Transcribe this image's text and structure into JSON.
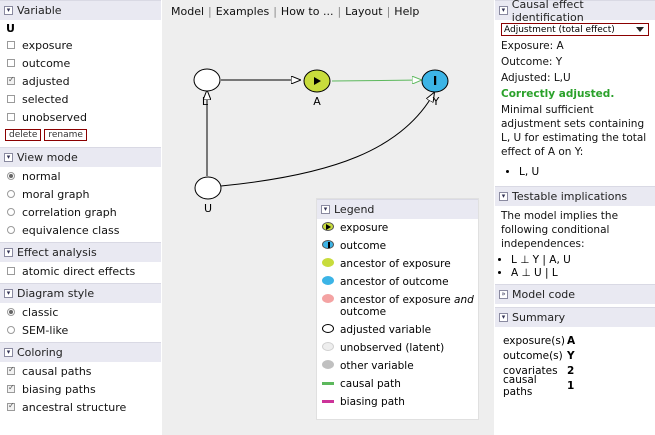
{
  "menu": {
    "items": [
      "Model",
      "Examples",
      "How to ...",
      "Layout",
      "Help"
    ]
  },
  "variable_panel": {
    "title": "Variable",
    "current_variable": "U",
    "options": [
      {
        "label": "exposure",
        "checked": false
      },
      {
        "label": "outcome",
        "checked": false
      },
      {
        "label": "adjusted",
        "checked": true
      },
      {
        "label": "selected",
        "checked": false
      },
      {
        "label": "unobserved",
        "checked": false
      }
    ],
    "delete_label": "delete",
    "rename_label": "rename"
  },
  "view_mode": {
    "title": "View mode",
    "options": [
      {
        "label": "normal",
        "selected": true
      },
      {
        "label": "moral graph",
        "selected": false
      },
      {
        "label": "correlation graph",
        "selected": false
      },
      {
        "label": "equivalence class",
        "selected": false
      }
    ]
  },
  "effect_analysis": {
    "title": "Effect analysis",
    "options": [
      {
        "label": "atomic direct effects",
        "checked": false
      }
    ]
  },
  "diagram_style": {
    "title": "Diagram style",
    "options": [
      {
        "label": "classic",
        "selected": true
      },
      {
        "label": "SEM-like",
        "selected": false
      }
    ]
  },
  "coloring": {
    "title": "Coloring",
    "options": [
      {
        "label": "causal paths",
        "checked": true
      },
      {
        "label": "biasing paths",
        "checked": true
      },
      {
        "label": "ancestral structure",
        "checked": true
      }
    ]
  },
  "graph": {
    "nodes": [
      {
        "id": "L",
        "label": "L",
        "role": "adjusted"
      },
      {
        "id": "A",
        "label": "A",
        "role": "exposure"
      },
      {
        "id": "Y",
        "label": "Y",
        "role": "outcome"
      },
      {
        "id": "U",
        "label": "U",
        "role": "adjusted"
      }
    ],
    "edges": [
      {
        "from": "L",
        "to": "A",
        "type": "plain"
      },
      {
        "from": "A",
        "to": "Y",
        "type": "causal"
      },
      {
        "from": "U",
        "to": "L",
        "type": "plain"
      },
      {
        "from": "U",
        "to": "Y",
        "type": "plain"
      }
    ],
    "colors": {
      "exposure": "#c8dc3c",
      "outcome": "#3cb4e6",
      "causal": "#5cb85c",
      "biasing": "#cc3399",
      "anc_both": "#f4a3a3",
      "unobserved": "#eeeeee",
      "other": "#c0c0c0"
    }
  },
  "legend": {
    "title": "Legend",
    "items": [
      {
        "label": "exposure",
        "symbol": "exposure-icon"
      },
      {
        "label": "outcome",
        "symbol": "outcome-icon"
      },
      {
        "label": "ancestor of exposure",
        "symbol": "ancestor-exposure-icon"
      },
      {
        "label": "ancestor of outcome",
        "symbol": "ancestor-outcome-icon"
      },
      {
        "label_a": "ancestor of exposure ",
        "label_em": "and",
        "label_b": "outcome",
        "symbol": "ancestor-both-icon"
      },
      {
        "label": "adjusted variable",
        "symbol": "adjusted-icon"
      },
      {
        "label": "unobserved (latent)",
        "symbol": "unobserved-icon"
      },
      {
        "label": "other variable",
        "symbol": "other-icon"
      },
      {
        "label": "causal path",
        "symbol": "causal-path-icon"
      },
      {
        "label": "biasing path",
        "symbol": "biasing-path-icon"
      }
    ]
  },
  "causal_panel": {
    "title": "Causal effect identification",
    "select_value": "Adjustment (total effect)",
    "exposure_line": "Exposure: A",
    "outcome_line": "Outcome: Y",
    "adjusted_line": "Adjusted: L,U",
    "status": "Correctly adjusted.",
    "description": "Minimal sufficient adjustment sets containing L, U for estimating the total effect of A on Y:",
    "sets": [
      "L, U"
    ]
  },
  "testable_panel": {
    "title": "Testable implications",
    "description": "The model implies the following conditional independences:",
    "items": [
      "L ⊥ Y | A, U",
      "A ⊥ U | L"
    ]
  },
  "model_code_panel": {
    "title": "Model code"
  },
  "summary_panel": {
    "title": "Summary",
    "rows": [
      {
        "key": "exposure(s)",
        "value": "A"
      },
      {
        "key": "outcome(s)",
        "value": "Y"
      },
      {
        "key": "covariates",
        "value": "2"
      },
      {
        "key": "causal paths",
        "value": "1"
      }
    ]
  }
}
